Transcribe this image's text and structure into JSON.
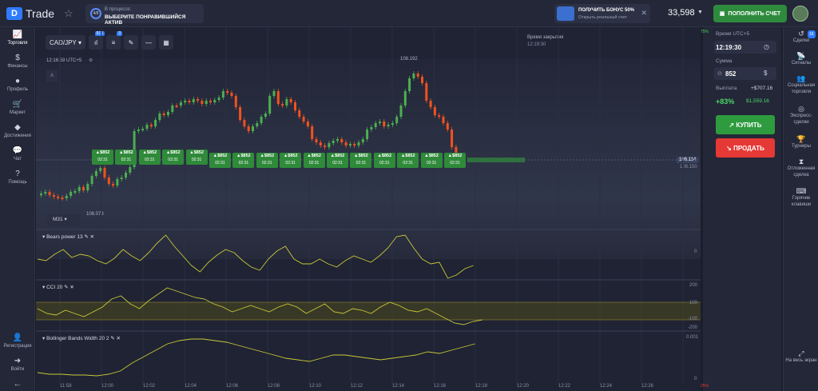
{
  "app": {
    "logo_text": "Trade"
  },
  "asset_selector": {
    "line1": "В процессе:",
    "line2": "ВЫБЕРИТЕ ПОНРАВИВШИЙСЯ АКТИВ",
    "progress": "4/8"
  },
  "bonus": {
    "title": "ПОЛУЧИТЬ БОНУС 50%",
    "subtitle": "Открыть реальный счет"
  },
  "balance": "33,598",
  "deposit_label": "ПОПОЛНИТЬ СЧЕТ",
  "left_nav": [
    {
      "label": "Торговля",
      "icon": "chart-icon"
    },
    {
      "label": "Финансы",
      "icon": "dollar-icon"
    },
    {
      "label": "Профиль",
      "icon": "user-icon"
    },
    {
      "label": "Маркет",
      "icon": "cart-icon"
    },
    {
      "label": "Достижения",
      "icon": "diamond-icon"
    },
    {
      "label": "Чат",
      "icon": "chat-icon"
    },
    {
      "label": "Помощь",
      "icon": "help-icon"
    }
  ],
  "left_nav_bottom": [
    {
      "label": "Регистрация"
    },
    {
      "label": "Войти"
    }
  ],
  "right_nav": [
    {
      "label": "Сделки",
      "badge": "16"
    },
    {
      "label": "Сигналы"
    },
    {
      "label": "Социальная торговля"
    },
    {
      "label": "Экспресс-сделки"
    },
    {
      "label": "Турниры"
    },
    {
      "label": "Отложенная сделка"
    },
    {
      "label": "Горячие клавиши"
    },
    {
      "label": "На весь экран"
    }
  ],
  "chart": {
    "pair": "CAD/JPY",
    "time": "12:16:59 UTC+5",
    "timeframe": "M31",
    "high_label": "108.192",
    "low_label": "108.073",
    "current_price": "108.114",
    "price_below": "108.150",
    "close_label": "Время закрытия",
    "close_time": "12:19:30",
    "indicators_badge": "515",
    "tools_badge": "3",
    "a_label": "A"
  },
  "trade_tags": {
    "amount": "$852",
    "time": "02:31",
    "count": 16
  },
  "indicators": [
    {
      "label": "Bears power 13",
      "zero": "0"
    },
    {
      "label": "CCI 20",
      "levels": [
        "200",
        "100",
        "-100",
        "-200"
      ]
    },
    {
      "label": "Bollinger Bands Width 20 2",
      "levels": [
        "0.001",
        "0"
      ]
    }
  ],
  "x_axis": [
    "11:58",
    "12:00",
    "12:02",
    "12:04",
    "12:06",
    "12:08",
    "12:10",
    "12:12",
    "12:14",
    "12:16",
    "12:18",
    "12:20",
    "12:22",
    "12:24",
    "12:26"
  ],
  "panel": {
    "time_label": "Время UTC+5",
    "time_value": "12:19:30",
    "amount_label": "Сумма",
    "amount_value": "852",
    "payout_label": "Выплата",
    "payout_value": "+$707.16",
    "percent": "+83%",
    "total": "$1,559.16",
    "buy": "КУПИТЬ",
    "sell": "ПРОДАТЬ",
    "bar_top": "75%",
    "bar_bottom": "25%"
  }
}
